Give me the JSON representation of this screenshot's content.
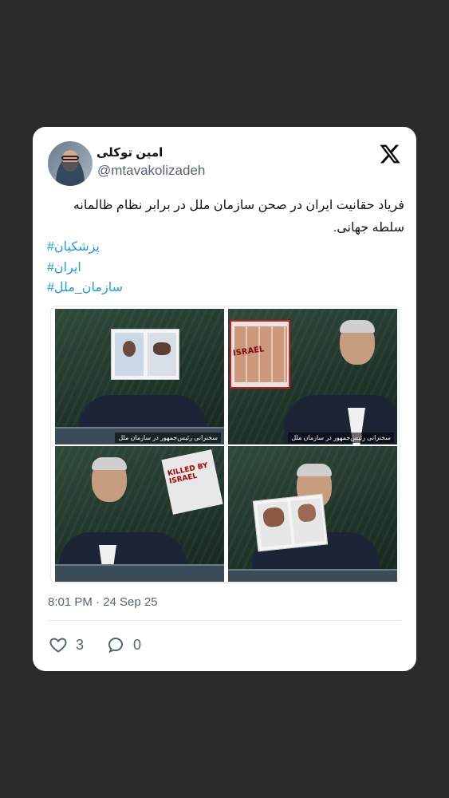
{
  "tweet": {
    "display_name": "امین توکلی",
    "handle": "@mtavakolizadeh",
    "text": "فریاد حقانیت ایران در صحن سازمان ملل در برابر نظام ظالمانه سلطه جهانی.",
    "hashtags": [
      "#پزشکیان",
      "#ایران",
      "#سازمان_ملل"
    ],
    "timestamp": "8:01 PM · 24 Sep 25",
    "likes": "3",
    "replies": "0"
  },
  "media": {
    "captions": [
      "سخنرانی رئیس‌جمهور در سازمان ملل",
      "سخنرانی رئیس‌جمهور در سازمان ملل"
    ],
    "poster_text_1": "ISRAEL",
    "poster_text_2": "KILLED BY ISRAEL"
  },
  "icons": {
    "logo": "x-logo-icon",
    "like": "heart-icon",
    "reply": "reply-bubble-icon"
  },
  "colors": {
    "background": "#2a2a2a",
    "card": "#ffffff",
    "hashtag": "#1d9bf0",
    "secondary_text": "#536471"
  }
}
